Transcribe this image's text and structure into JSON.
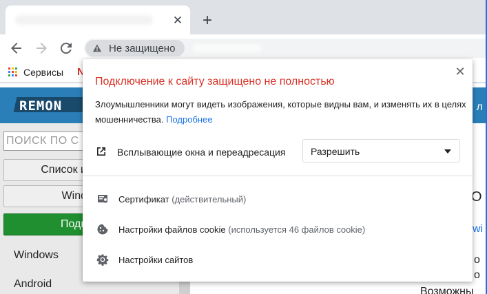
{
  "browser": {
    "tab": {
      "title": "",
      "close_icon": "close-icon"
    },
    "new_tab_icon": "plus-icon",
    "back_icon": "arrow-left-icon",
    "forward_icon": "arrow-right-icon",
    "reload_icon": "reload-icon",
    "security_chip": {
      "label": "Не защищено",
      "icon": "warning-icon"
    },
    "url": "",
    "bookmarks": {
      "apps_label": "Сервисы",
      "next_fragment": "N"
    }
  },
  "page": {
    "logo_text": "REMON",
    "header_right_fragment": "л",
    "search_placeholder": "ПОИСК ПО С",
    "buttons": {
      "list": "Список и",
      "windows": "Wind",
      "subscribe": "Подп"
    },
    "side_links": {
      "windows": "Windows",
      "android": "Android"
    },
    "right_fragments": [
      "О",
      "wi",
      "о",
      "о",
      "Возможны"
    ]
  },
  "popup": {
    "title": "Подключение к сайту защищено не полностью",
    "description": "Злоумышленники могут видеть изображения, которые видны вам, и изменять их в целях мошенничества.",
    "link": "Подробнее",
    "permission": {
      "label": "Всплывающие окна и переадресация",
      "value": "Разрешить",
      "icon": "open-in-new-icon"
    },
    "certificate": {
      "label": "Сертификат",
      "note": "(действительный)",
      "icon": "certificate-icon"
    },
    "cookies": {
      "label": "Настройки файлов cookie",
      "note": "(используется 46 файлов cookie)",
      "icon": "cookie-icon"
    },
    "site_settings": {
      "label": "Настройки сайтов",
      "icon": "gear-icon"
    }
  },
  "colors": {
    "warning_red": "#d93025",
    "link_blue": "#1a73e8",
    "site_header_blue": "#2a7fb8",
    "subscribe_green": "#1f8f2f"
  }
}
